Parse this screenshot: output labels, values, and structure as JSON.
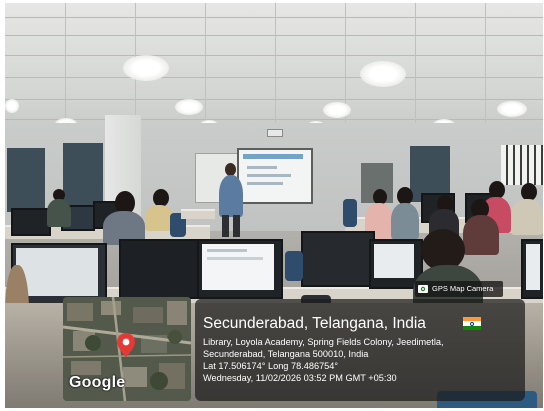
{
  "overlay": {
    "app_badge": "GPS Map Camera",
    "location_title": "Secunderabad, Telangana, India",
    "address_line1": "Library, Loyola Academy, Spring Fields Colony, Jeedimetla,",
    "address_line2": "Secunderabad, Telangana 500010, India",
    "coordinates": "Lat 17.506174° Long 78.486754°",
    "datetime": "Wednesday, 11/02/2026 03:52 PM GMT +05:30",
    "map_logo": "Google",
    "flag_colors": [
      "#ff9933",
      "#ffffff",
      "#138808"
    ],
    "pin_color": "#e53935"
  },
  "scene": {
    "description_icons": [
      "camera-icon",
      "map-pin-icon",
      "india-flag-icon"
    ]
  }
}
